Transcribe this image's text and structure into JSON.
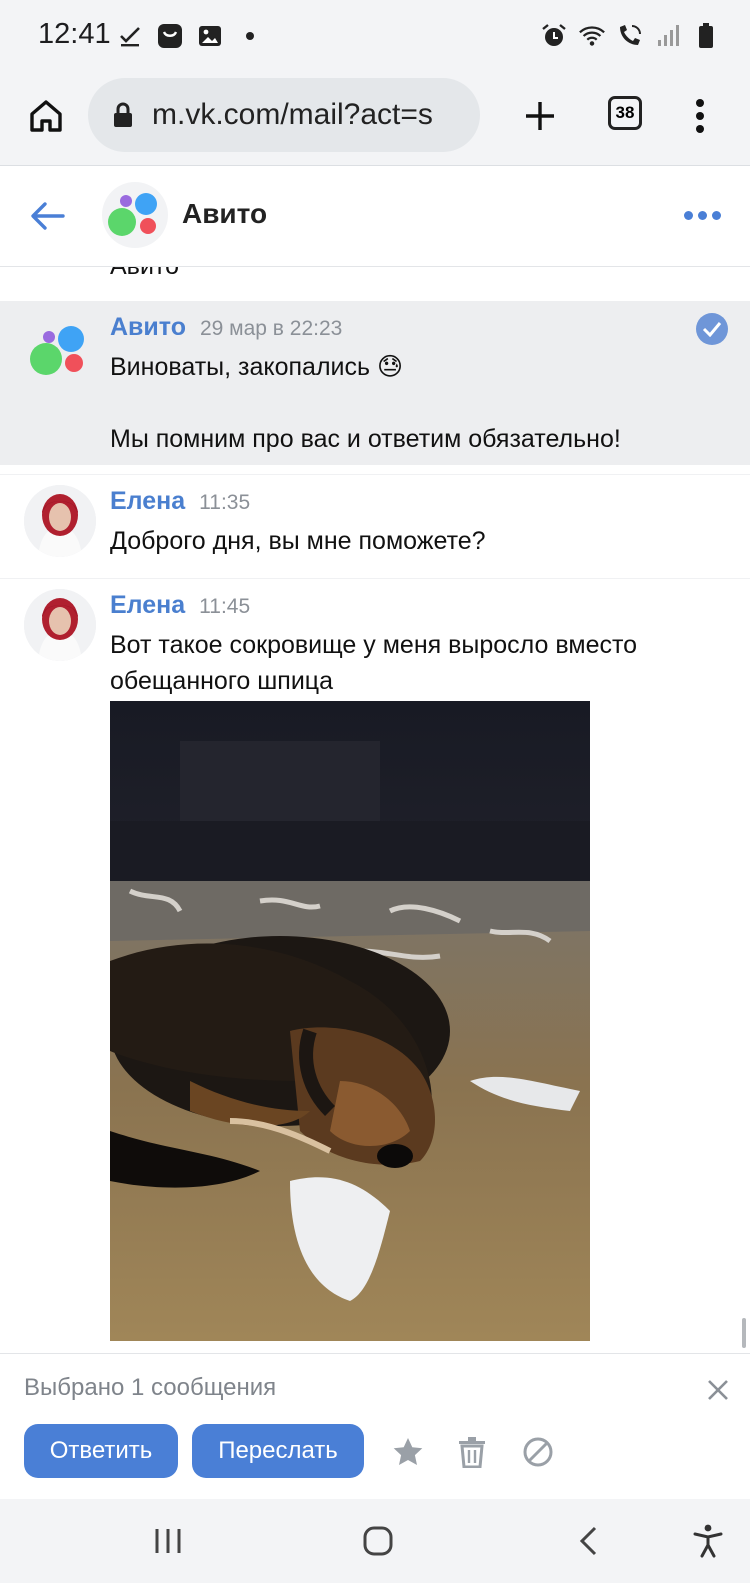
{
  "status_bar": {
    "time": "12:41",
    "left_icons": [
      "check-icon",
      "app-notification-icon",
      "image-icon",
      "dot-icon"
    ],
    "right_icons": [
      "alarm-icon",
      "wifi-icon",
      "wifi-calling-icon",
      "signal-icon",
      "battery-icon"
    ]
  },
  "browser": {
    "url": "m.vk.com/mail?act=s",
    "tab_count": "38"
  },
  "chat_header": {
    "title": "Авито"
  },
  "messages": {
    "cut_text": "Авито",
    "avito": {
      "author": "Авито",
      "time": "29 мар в 22:23",
      "line1": "Виноваты, закопались 😓",
      "line2": "Мы помним про вас и ответим обязательно!"
    },
    "elena1": {
      "author": "Елена",
      "time": "11:35",
      "text": "Доброго дня, вы мне поможете?"
    },
    "elena2": {
      "author": "Елена",
      "time": "11:45",
      "line1": "Вот такое сокровище у меня выросло вместо",
      "line2": "обещанного шпица"
    }
  },
  "selection_bar": {
    "count_text": "Выбрано 1 сообщения",
    "reply_label": "Ответить",
    "forward_label": "Переслать"
  },
  "colors": {
    "accent": "#4a7fd6",
    "selected_bg": "#edeef0",
    "avito_green": "#5bd66b",
    "avito_blue": "#3fa3f5",
    "avito_red": "#f0505a",
    "avito_purple": "#9a6bdf"
  }
}
